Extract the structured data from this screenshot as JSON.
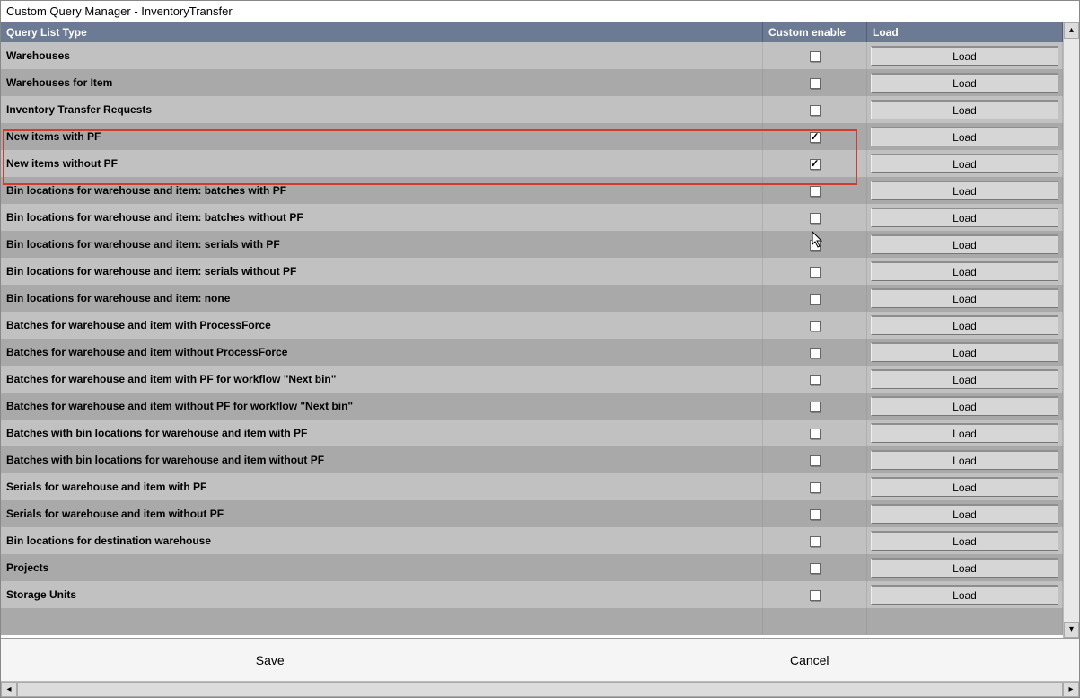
{
  "window": {
    "title": "Custom Query Manager - InventoryTransfer"
  },
  "columns": {
    "query_list_type": "Query List Type",
    "custom_enable": "Custom enable",
    "load": "Load"
  },
  "load_button_label": "Load",
  "footer": {
    "save": "Save",
    "cancel": "Cancel"
  },
  "rows": [
    {
      "label": "Warehouses",
      "checked": false
    },
    {
      "label": "Warehouses for Item",
      "checked": false
    },
    {
      "label": "Inventory Transfer Requests",
      "checked": false
    },
    {
      "label": "New items with PF",
      "checked": true
    },
    {
      "label": "New items without PF",
      "checked": true
    },
    {
      "label": "Bin locations for warehouse and item: batches with PF",
      "checked": false
    },
    {
      "label": "Bin locations for warehouse and item: batches without PF",
      "checked": false
    },
    {
      "label": "Bin locations for warehouse and item: serials with PF",
      "checked": false
    },
    {
      "label": "Bin locations for warehouse and item: serials without PF",
      "checked": false
    },
    {
      "label": "Bin locations for warehouse and item: none",
      "checked": false
    },
    {
      "label": "Batches for warehouse and item with ProcessForce",
      "checked": false
    },
    {
      "label": "Batches for warehouse and item without ProcessForce",
      "checked": false
    },
    {
      "label": "Batches for warehouse and item with PF for workflow \"Next bin\"",
      "checked": false
    },
    {
      "label": "Batches for warehouse and item without PF for workflow \"Next bin\"",
      "checked": false
    },
    {
      "label": "Batches with bin locations for warehouse and item with PF",
      "checked": false
    },
    {
      "label": "Batches with bin locations for warehouse and item without PF",
      "checked": false
    },
    {
      "label": "Serials for warehouse and item with PF",
      "checked": false
    },
    {
      "label": "Serials for warehouse and item without PF",
      "checked": false
    },
    {
      "label": "Bin locations for destination warehouse",
      "checked": false
    },
    {
      "label": "Projects",
      "checked": false
    },
    {
      "label": "Storage Units",
      "checked": false
    }
  ],
  "highlight_rows": [
    3,
    4
  ]
}
